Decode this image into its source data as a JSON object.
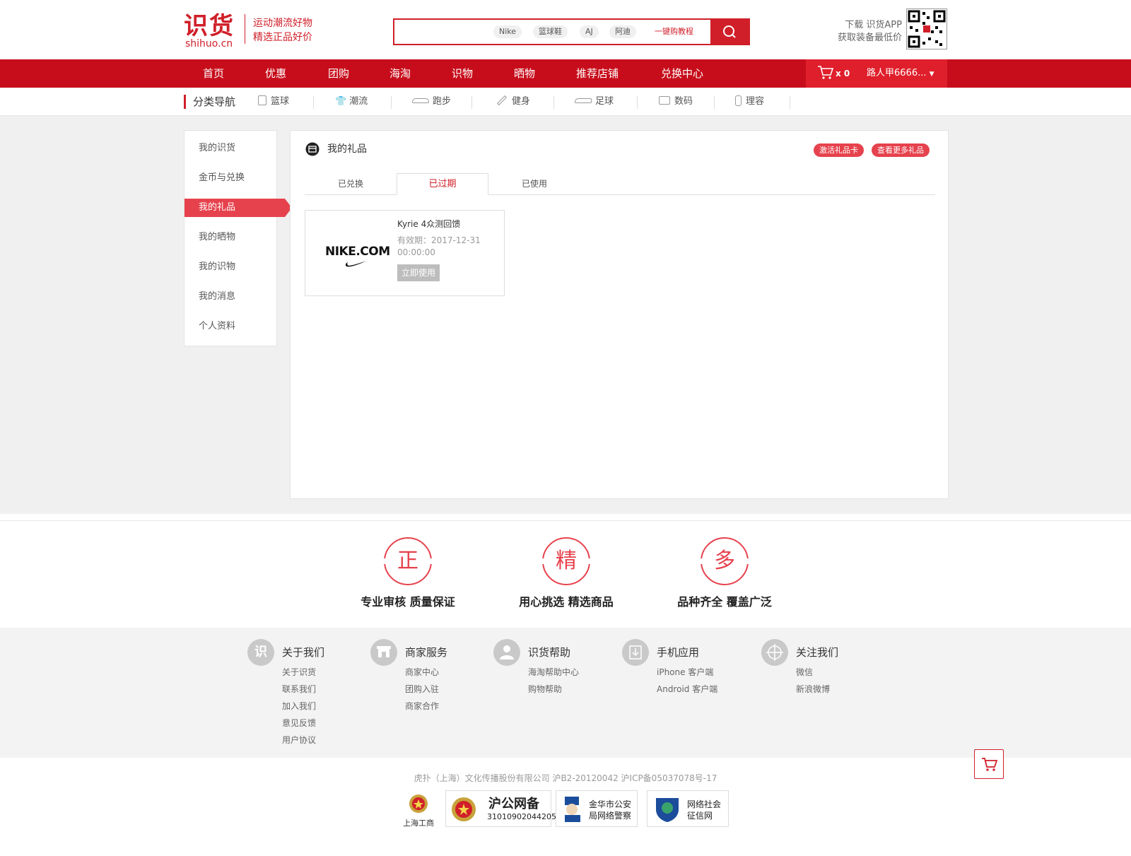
{
  "header": {
    "logo_cn": "识货",
    "logo_domain": "shihuo.cn",
    "slogan_1": "运动潮流好物",
    "slogan_2": "精选正品好价",
    "search_tags": [
      "Nike",
      "篮球鞋",
      "AJ",
      "阿迪"
    ],
    "search_link": "一键购教程",
    "app_line_1": "下载 识货APP",
    "app_line_2": "获取装备最低价"
  },
  "nav": {
    "items": [
      "首页",
      "优惠",
      "团购",
      "海淘",
      "识物",
      "晒物",
      "推荐店铺",
      "兑换中心"
    ],
    "cart_count": "x 0",
    "user": "路人甲6666..."
  },
  "categories": {
    "title": "分类导航",
    "items": [
      "篮球",
      "潮流",
      "跑步",
      "健身",
      "足球",
      "数码",
      "理容"
    ]
  },
  "sidebar": {
    "items": [
      "我的识货",
      "金币与兑换",
      "我的礼品",
      "我的晒物",
      "我的识物",
      "我的消息",
      "个人资料"
    ],
    "active_index": 2
  },
  "panel": {
    "title": "我的礼品",
    "buttons": [
      "激活礼品卡",
      "查看更多礼品"
    ],
    "tabs": [
      "已兑换",
      "已过期",
      "已使用"
    ],
    "active_tab": 1,
    "gift": {
      "brand": "NIKE.COM",
      "name": "Kyrie 4众测回馈",
      "expiry": "有效期：2017-12-31 00:00:00",
      "use_label": "立即使用"
    }
  },
  "features": [
    {
      "char": "正",
      "text": "专业审核 质量保证"
    },
    {
      "char": "精",
      "text": "用心挑选 精选商品"
    },
    {
      "char": "多",
      "text": "品种齐全 覆盖广泛"
    }
  ],
  "footer": {
    "columns": [
      {
        "icon": "识",
        "title": "关于我们",
        "links": [
          "关于识货",
          "联系我们",
          "加入我们",
          "意见反馈",
          "用户协议"
        ]
      },
      {
        "icon": "",
        "title": "商家服务",
        "links": [
          "商家中心",
          "团购入驻",
          "商家合作"
        ]
      },
      {
        "icon": "",
        "title": "识货帮助",
        "links": [
          "海淘帮助中心",
          "购物帮助"
        ]
      },
      {
        "icon": "",
        "title": "手机应用",
        "links": [
          "iPhone 客户端",
          "Android 客户端"
        ]
      },
      {
        "icon": "",
        "title": "关注我们",
        "links": [
          "微信",
          "新浪微博"
        ]
      }
    ],
    "copyright": "虎扑（上海）文化传播股份有限公司 沪B2-20120042  沪ICP备05037078号-17",
    "badges": [
      {
        "title": "上海工商"
      },
      {
        "title": "沪公网备",
        "sub": "31010902044205"
      },
      {
        "title": "金华市公安",
        "sub": "局网络警察"
      },
      {
        "title": "网络社会",
        "sub": "征信网"
      }
    ]
  },
  "colors": {
    "brand_red": "#d01f29",
    "accent_red": "#e6424d",
    "nav_red": "#c70d1b"
  }
}
